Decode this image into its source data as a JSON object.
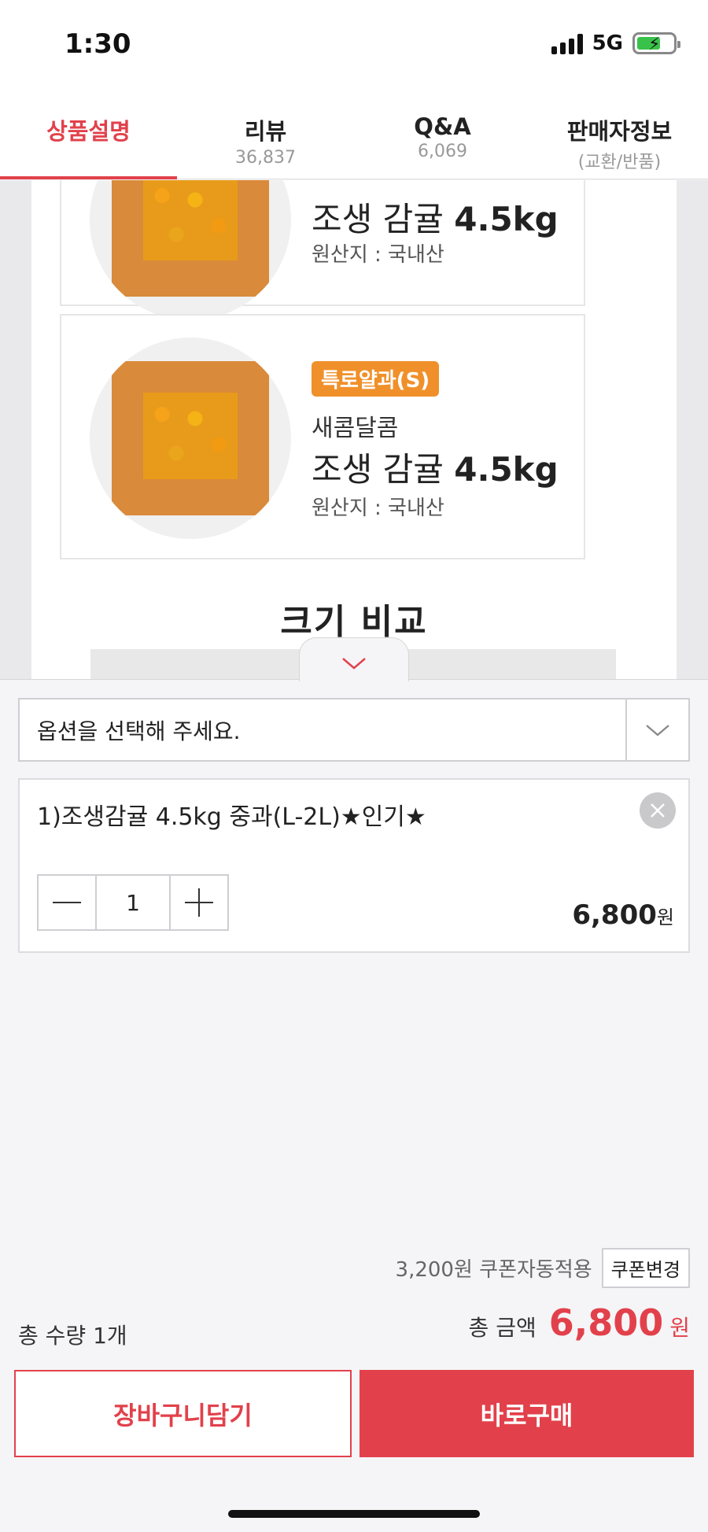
{
  "status": {
    "time": "1:30",
    "network": "5G"
  },
  "tabs": [
    {
      "label": "상품설명",
      "sub": "",
      "active": true
    },
    {
      "label": "리뷰",
      "sub": "36,837",
      "active": false
    },
    {
      "label": "Q&A",
      "sub": "6,069",
      "active": false
    },
    {
      "label": "판매자정보",
      "sub": "(교환/반품)",
      "active": false
    }
  ],
  "content": {
    "card1": {
      "title_prefix": "조생 감귤",
      "title_weight": "4.5kg",
      "origin": "원산지 : 국내산"
    },
    "card2": {
      "tag": "특로얄과(S)",
      "subtitle": "새콤달콤",
      "title_prefix": "조생 감귤",
      "title_weight": "4.5kg",
      "origin": "원산지 : 국내산"
    },
    "compare_title": "크기 비교"
  },
  "sheet": {
    "select_placeholder": "옵션을 선택해 주세요.",
    "option": {
      "name": "1)조생감귤 4.5kg 중과(L-2L)★인기★",
      "quantity": "1",
      "price": "6,800",
      "price_unit": "원"
    },
    "coupon": {
      "text": "3,200원 쿠폰자동적용",
      "button": "쿠폰변경"
    },
    "total": {
      "qty_text": "총 수량 1개",
      "amount_label": "총 금액",
      "amount": "6,800",
      "amount_unit": "원"
    },
    "actions": {
      "cart": "장바구니담기",
      "buy": "바로구매"
    }
  },
  "colors": {
    "accent": "#e2414b",
    "tag_orange": "#f0902a"
  }
}
